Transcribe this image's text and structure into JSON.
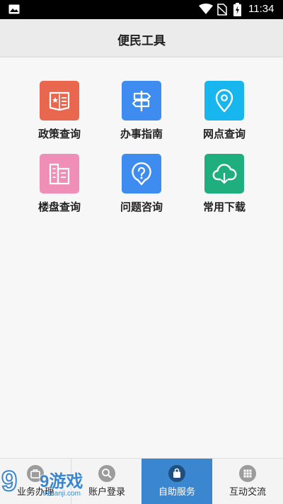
{
  "status_bar": {
    "time": "11:34",
    "icons": [
      "image-icon",
      "wifi-icon",
      "no-sim-icon",
      "battery-charging-icon"
    ]
  },
  "header": {
    "title": "便民工具"
  },
  "tools": [
    {
      "label": "政策查询",
      "icon": "policy-book-icon",
      "color": "#e8674e"
    },
    {
      "label": "办事指南",
      "icon": "signpost-icon",
      "color": "#3f8cf0"
    },
    {
      "label": "网点查询",
      "icon": "location-pin-icon",
      "color": "#18b6ee"
    },
    {
      "label": "楼盘查询",
      "icon": "building-icon",
      "color": "#ef8fb8"
    },
    {
      "label": "问题咨询",
      "icon": "question-bubble-icon",
      "color": "#3f8cf0"
    },
    {
      "label": "常用下载",
      "icon": "cloud-download-icon",
      "color": "#1fae7e"
    }
  ],
  "tabbar": {
    "tabs": [
      {
        "label": "业务办理",
        "icon": "briefcase-icon",
        "active": false
      },
      {
        "label": "账户登录",
        "icon": "search-icon",
        "active": false
      },
      {
        "label": "自助服务",
        "icon": "bag-icon",
        "active": true
      },
      {
        "label": "互动交流",
        "icon": "grid-icon",
        "active": false
      }
    ],
    "active_color": "#3a87cf"
  },
  "watermark": {
    "num": "9",
    "text": "9游戏",
    "url": "91danji.com"
  }
}
